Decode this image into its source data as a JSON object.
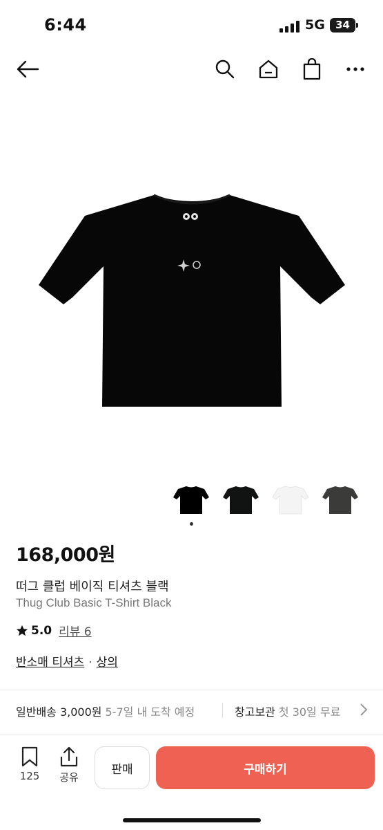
{
  "status_bar": {
    "time": "6:44",
    "network": "5G",
    "battery": "34"
  },
  "nav": {
    "icons": [
      "back-arrow-icon",
      "search-icon",
      "home-icon",
      "shopping-bag-icon",
      "more-icon"
    ]
  },
  "product": {
    "price": "168,000원",
    "title_ko": "떠그 클럽 베이직 티셔츠 블랙",
    "title_en": "Thug Club Basic T-Shirt Black",
    "rating": "5.0",
    "review_label": "리뷰 6",
    "category_1": "반소매 티셔츠",
    "separator": "·",
    "category_2": "상의"
  },
  "thumbnails": {
    "colors": [
      "#000000",
      "#111312",
      "#f4f4f4",
      "#3b3c3a"
    ],
    "selected_index": 0
  },
  "shipping": {
    "label": "일반배송 3,000원",
    "eta": "5-7일 내 도착 예정",
    "storage_label": "창고보관",
    "storage_note": "첫 30일 무료"
  },
  "bottom": {
    "wishlist_count": "125",
    "share_label": "공유",
    "sell_label": "판매",
    "buy_label": "구매하기",
    "buy_color": "#ef6253"
  }
}
